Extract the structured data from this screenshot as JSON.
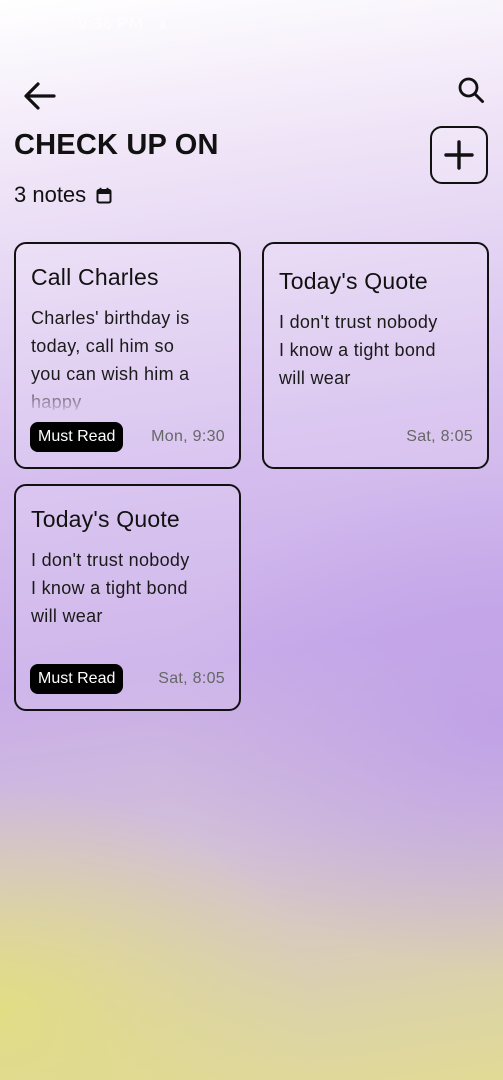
{
  "status_bar": {
    "time": "9:36 PM",
    "extra": "▲ ·"
  },
  "header": {
    "back_icon": "arrow-left-icon",
    "search_icon": "search-icon",
    "title": "CHECK UP ON",
    "add_icon": "plus-icon",
    "notes_count": "3 notes",
    "calendar_icon": "calendar-icon"
  },
  "notes": [
    {
      "title": "Call Charles",
      "body": "Charles' birthday is today, call him so you can wish him a happy",
      "tag": "Must Read",
      "time": "Mon, 9:30"
    },
    {
      "title": "Today's Quote",
      "body": "I don't trust nobody I know a tight bond will wear",
      "tag": "",
      "time": "Sat, 8:05"
    },
    {
      "title": "Today's Quote",
      "body": "I don't trust nobody I know a tight bond will wear",
      "tag": "Must Read",
      "time": "Sat, 8:05"
    }
  ],
  "colors": {
    "accent_text": "#111111",
    "badge_bg": "#000000",
    "badge_text": "#ffffff",
    "time_text": "#666666",
    "gradient_purple": "#c9ade9",
    "gradient_yellow": "#e1da95"
  }
}
